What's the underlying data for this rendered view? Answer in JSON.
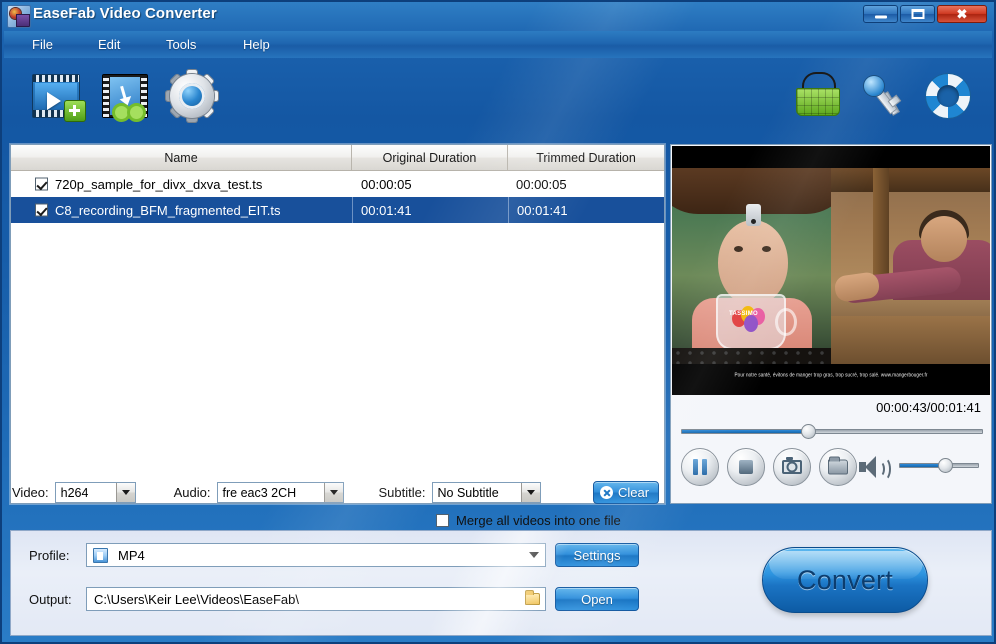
{
  "window": {
    "title": "EaseFab Video Converter",
    "app_icon": "app-logo-icon",
    "minimize_label": "Minimize",
    "maximize_label": "Maximize",
    "close_label": "✖"
  },
  "menubar": {
    "items": [
      {
        "label": "File"
      },
      {
        "label": "Edit"
      },
      {
        "label": "Tools"
      },
      {
        "label": "Help"
      }
    ]
  },
  "toolbar": {
    "left_buttons": [
      {
        "icon": "add-video-icon",
        "label": "Add Video"
      },
      {
        "icon": "trim-video-icon",
        "label": "Edit"
      },
      {
        "icon": "settings-gear-icon",
        "label": "Settings"
      }
    ],
    "right_buttons": [
      {
        "icon": "shopping-basket-icon",
        "label": "Buy"
      },
      {
        "icon": "key-icon",
        "label": "Register"
      },
      {
        "icon": "lifebuoy-icon",
        "label": "Support"
      }
    ]
  },
  "file_list": {
    "columns": [
      "Name",
      "Original Duration",
      "Trimmed Duration"
    ],
    "rows": [
      {
        "checked": true,
        "selected": false,
        "name": "720p_sample_for_divx_dxva_test.ts",
        "original_duration": "00:00:05",
        "trimmed_duration": "00:00:05"
      },
      {
        "checked": true,
        "selected": true,
        "name": "C8_recording_BFM_fragmented_EIT.ts",
        "original_duration": "00:01:41",
        "trimmed_duration": "00:01:41"
      }
    ]
  },
  "preview": {
    "time_display": "00:00:43/00:01:41",
    "seek_percent": 42,
    "volume_percent": 58,
    "subtitle_text": "Pour notre santé, évitons de manger trop gras, trop sucré, trop salé. www.mangerbouger.fr",
    "video_logo_text": "TASSIMO",
    "controls": [
      {
        "icon": "pause-icon",
        "label": "Pause"
      },
      {
        "icon": "stop-icon",
        "label": "Stop"
      },
      {
        "icon": "snapshot-camera-icon",
        "label": "Snapshot"
      },
      {
        "icon": "open-folder-icon",
        "label": "Open Folder"
      }
    ],
    "volume_icon": "speaker-icon"
  },
  "options": {
    "video_label": "Video:",
    "video_value": "h264",
    "audio_label": "Audio:",
    "audio_value": "fre eac3 2CH",
    "subtitle_label": "Subtitle:",
    "subtitle_value": "No Subtitle",
    "clear_label": "Clear",
    "clear_icon": "clear-x-icon"
  },
  "merge": {
    "label": "Merge all videos into one file",
    "checked": false
  },
  "bottom": {
    "profile_label": "Profile:",
    "profile_value": "MP4",
    "profile_icon": "profile-format-icon",
    "settings_label": "Settings",
    "output_label": "Output:",
    "output_value": "C:\\Users\\Keir Lee\\Videos\\EaseFab\\",
    "output_browse_icon": "folder-icon",
    "open_label": "Open",
    "convert_label": "Convert"
  },
  "colors": {
    "chrome_blue": "#1a5ca6",
    "accent_blue": "#1673c3",
    "selection_blue": "#18509b",
    "close_red": "#cf3a22",
    "panel_bg": "#e3e9f5"
  }
}
